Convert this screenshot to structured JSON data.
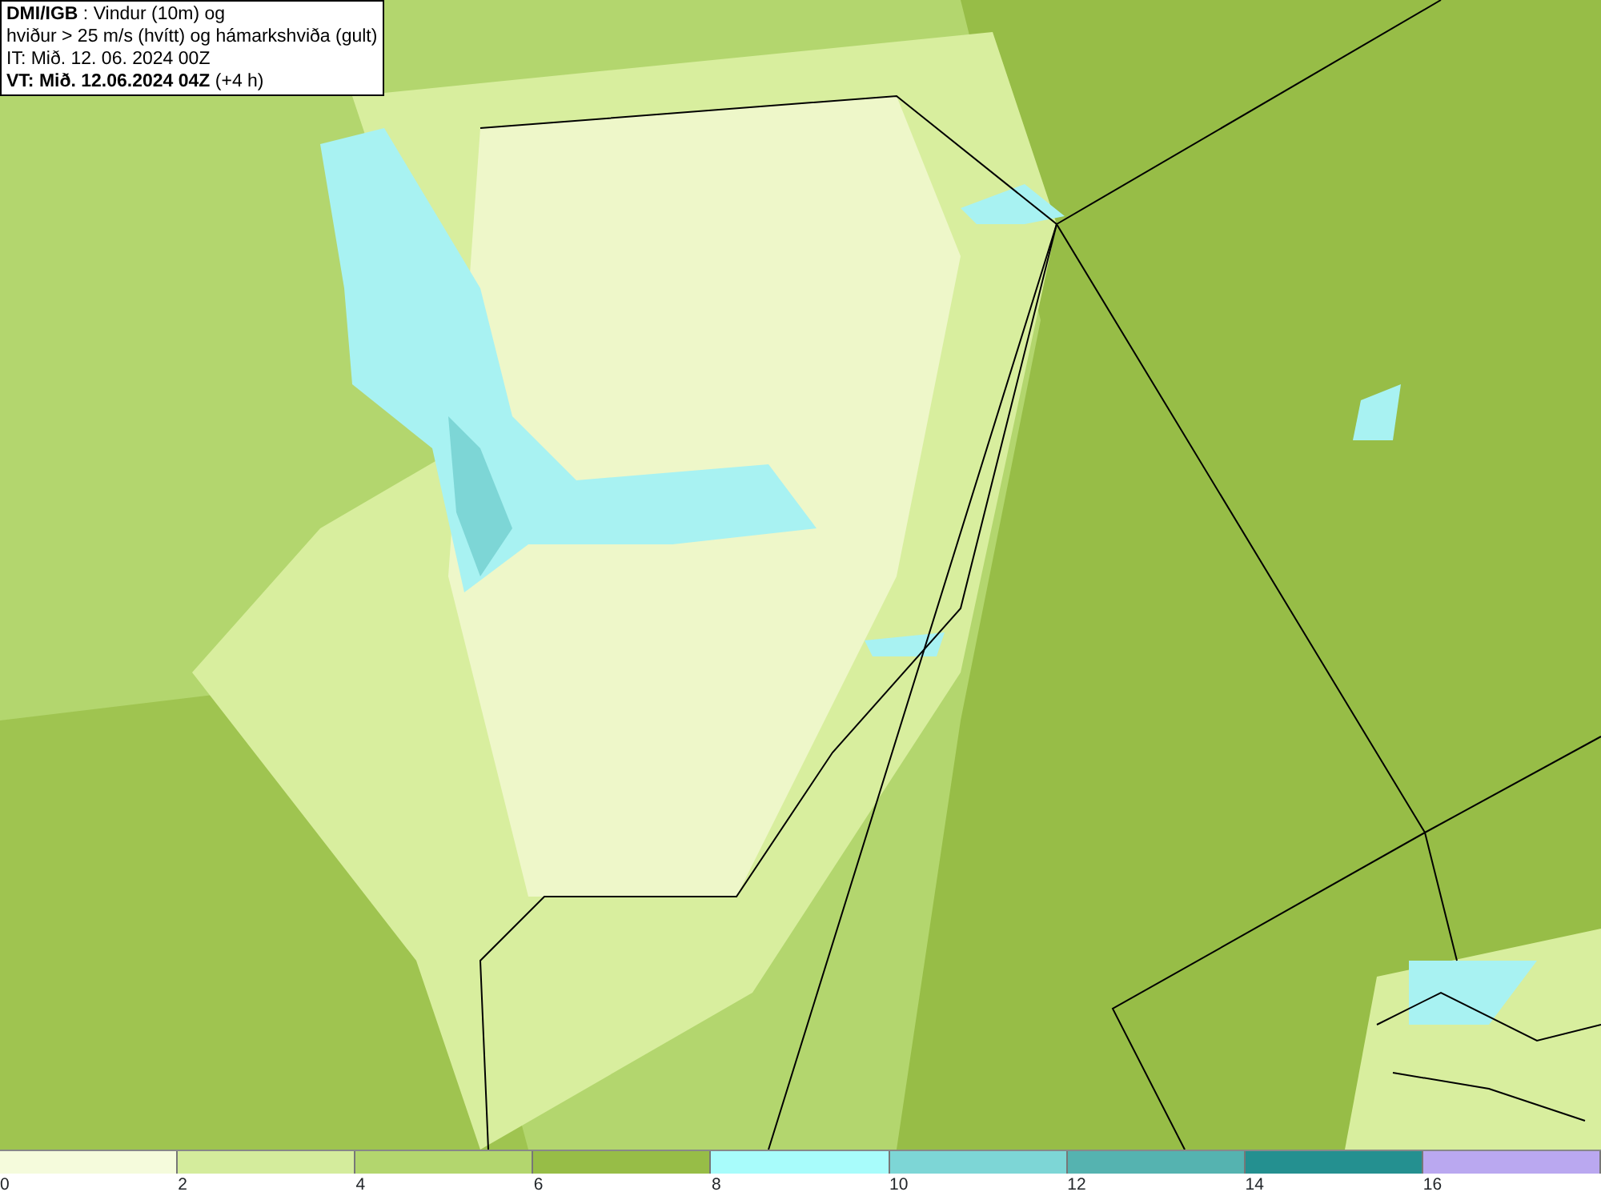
{
  "title_box": {
    "lines": [
      "**DMI/IGB** : Vindur (10m) og",
      "hviður > 25 m/s (hvítt) og hámarkshviða (gult)",
      "IT: Mið. 12. 06. 2024 00Z",
      "**VT: Mið. 12.06.2024 04Z** (+4 h)"
    ]
  },
  "legend": {
    "bins": [
      {
        "color": "#f5fbdc"
      },
      {
        "color": "#d4ec9c"
      },
      {
        "color": "#b3d66e"
      },
      {
        "color": "#97bd47"
      },
      {
        "color": "#a8fcfb"
      },
      {
        "color": "#7dd6d6"
      },
      {
        "color": "#55b3b0"
      },
      {
        "color": "#249090"
      },
      {
        "color": "#baa8f0"
      }
    ],
    "labels": [
      "0",
      "2",
      "4",
      "6",
      "8",
      "10",
      "12",
      "14",
      "16"
    ]
  }
}
